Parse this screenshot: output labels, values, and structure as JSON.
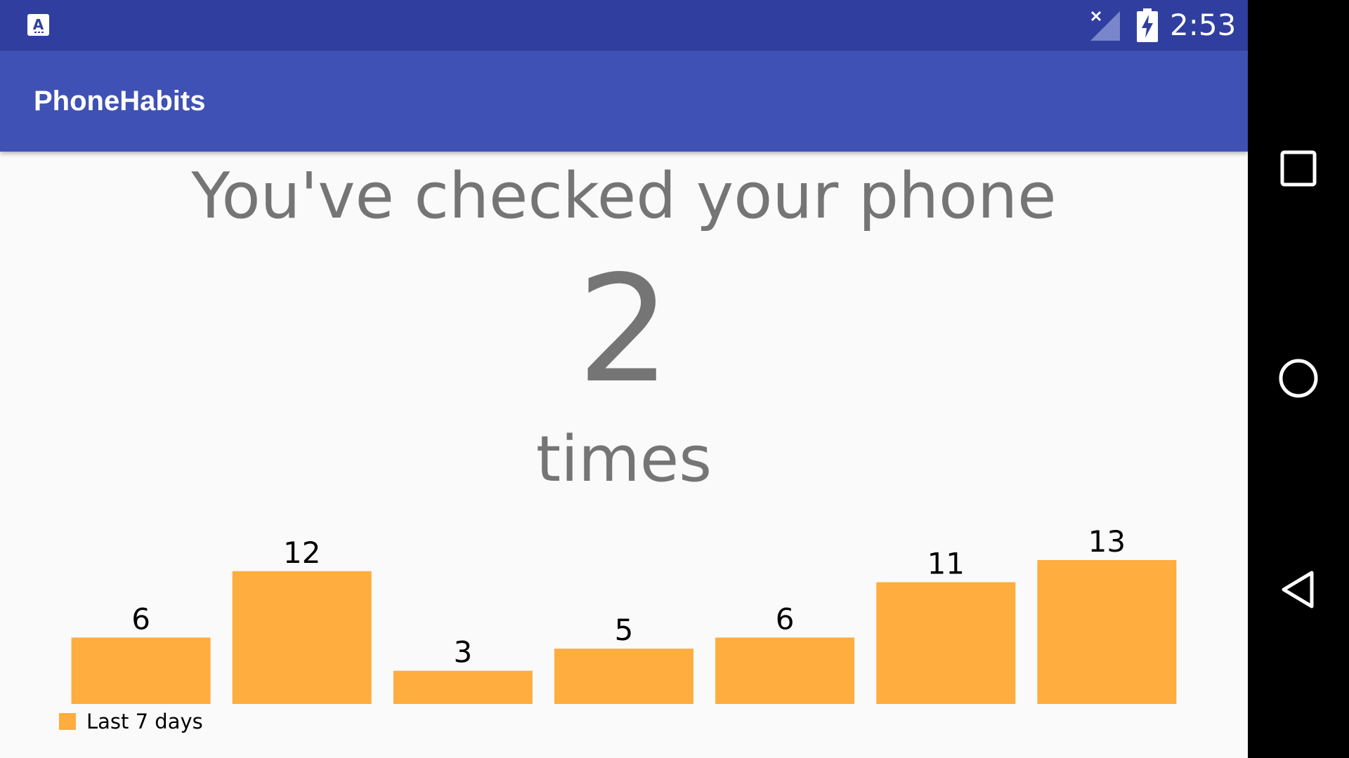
{
  "status_bar": {
    "time": "2:53",
    "notification_icon": "app-notification-icon",
    "signal_icon": "signal-no-service-icon",
    "battery_icon": "battery-charging-icon"
  },
  "app_bar": {
    "title": "PhoneHabits"
  },
  "main": {
    "headline": "You've checked your phone",
    "count": "2",
    "suffix": "times"
  },
  "chart_data": {
    "type": "bar",
    "categories": [
      "",
      "",
      "",
      "",
      "",
      "",
      ""
    ],
    "series": [
      {
        "name": "Last 7 days",
        "values": [
          6,
          12,
          3,
          5,
          6,
          11,
          13
        ]
      }
    ],
    "values": [
      6,
      12,
      3,
      5,
      6,
      11,
      13
    ],
    "legend": [
      "Last 7 days"
    ],
    "legend_position": "bottom-left",
    "ylim": [
      0,
      13
    ],
    "grid": false,
    "axes_visible": false,
    "data_labels": true,
    "bar_color": "#ffad3f"
  },
  "nav_bar": {
    "recents_icon": "recents-square-icon",
    "home_icon": "home-circle-icon",
    "back_icon": "back-triangle-icon"
  },
  "colors": {
    "status_bar": "#303f9f",
    "app_bar": "#3f51b5",
    "background": "#fafafa",
    "text_gray": "#757575",
    "bar": "#ffad3f"
  }
}
